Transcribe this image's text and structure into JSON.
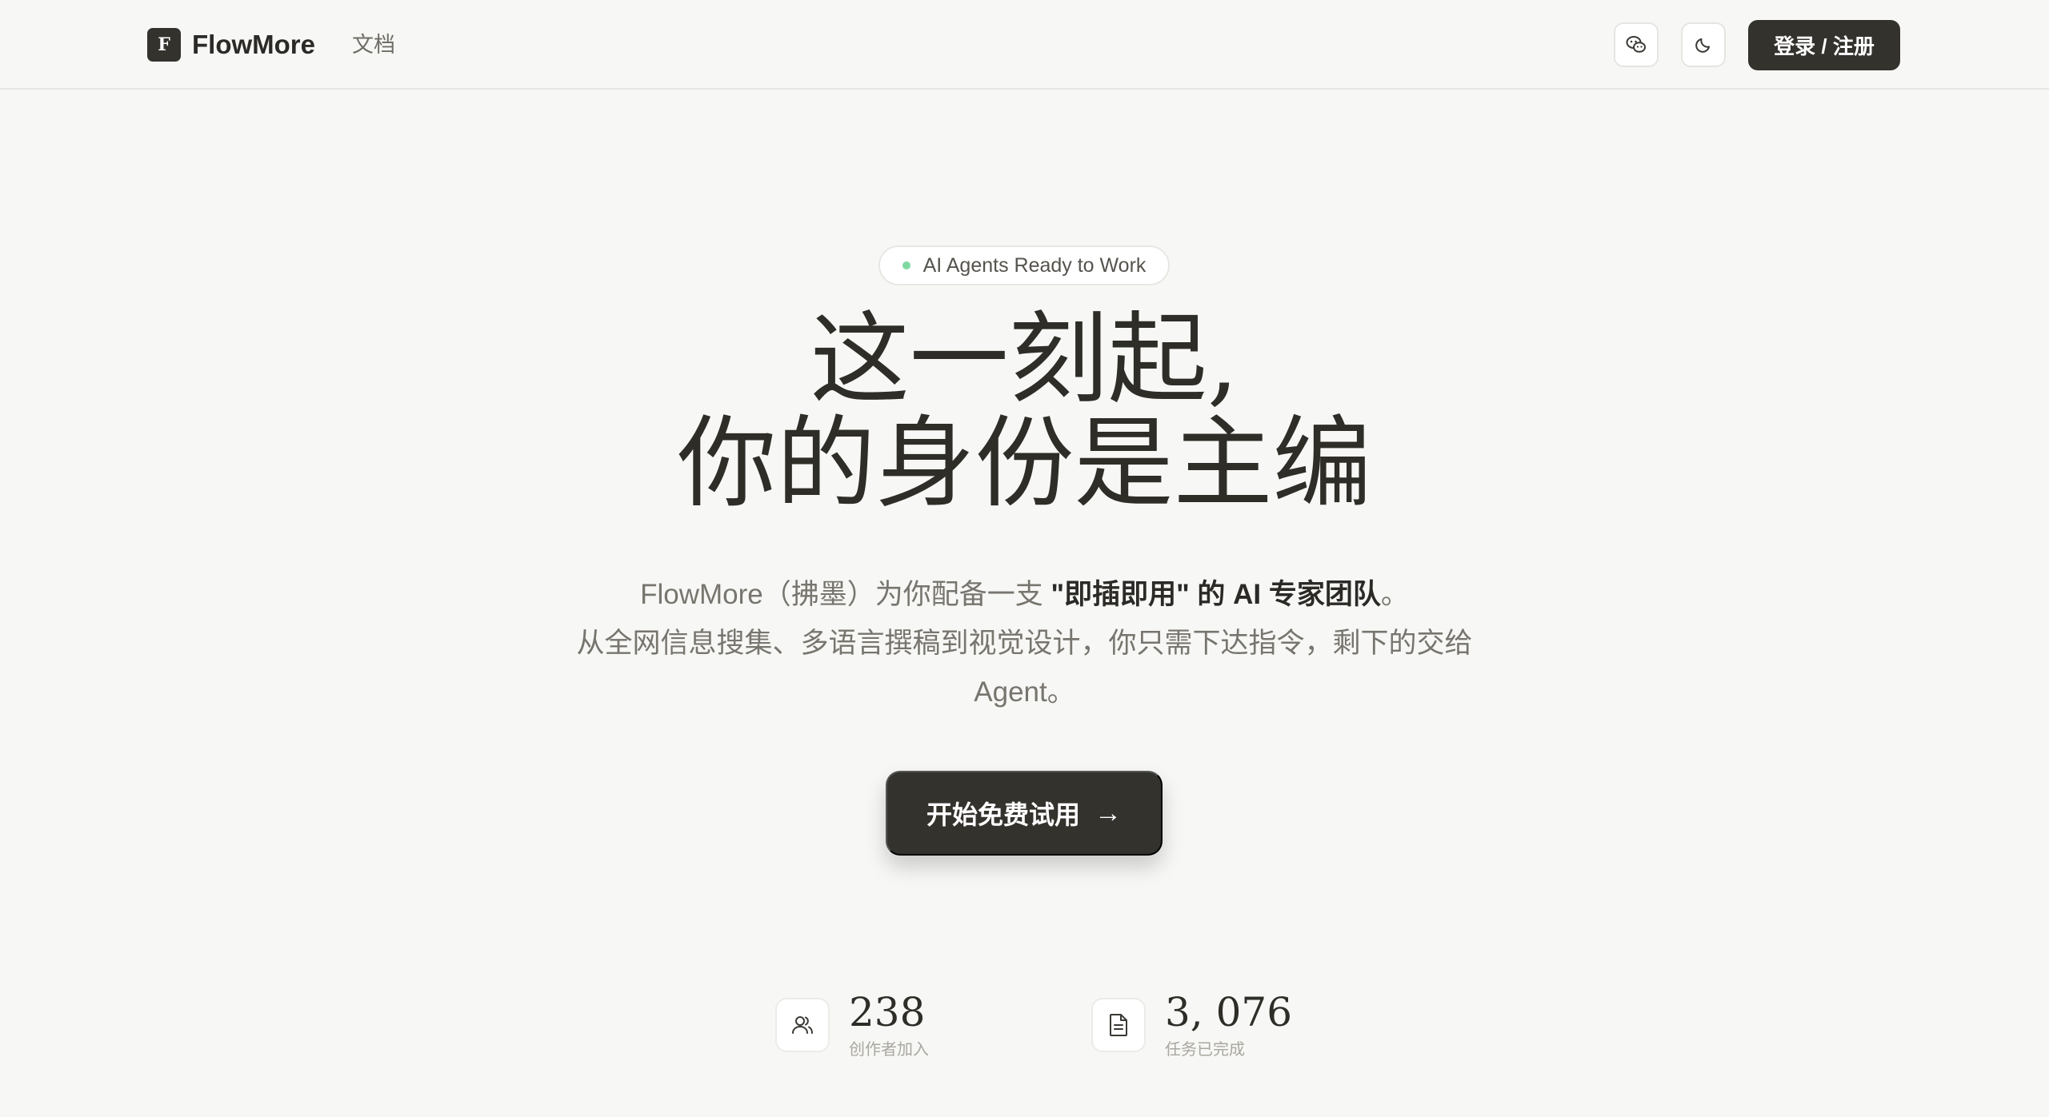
{
  "header": {
    "logo_letter": "F",
    "brand": "FlowMore",
    "nav_docs": "文档",
    "wechat_icon": "wechat-icon",
    "theme_icon": "moon-icon",
    "login_label": "登录 / 注册"
  },
  "hero": {
    "badge": "AI Agents Ready to Work",
    "badge_dot_color": "#7ed9a0",
    "title_line1": "这一刻起,",
    "title_line2": "你的身份是主编",
    "subtitle_line1_pre": "FlowMore（拂墨）为你配备一支 ",
    "subtitle_line1_bold": "\"即插即用\" 的 AI 专家团队",
    "subtitle_line1_post": "。",
    "subtitle_line2": "从全网信息搜集、多语言撰稿到视觉设计，你只需下达指令，剩下的交给",
    "subtitle_line3": "Agent。",
    "cta_label": "开始免费试用",
    "cta_arrow": "→"
  },
  "stats": [
    {
      "icon": "users-icon",
      "value": "238",
      "label": "创作者加入"
    },
    {
      "icon": "document-icon",
      "value": "3, 076",
      "label": "任务已完成"
    }
  ],
  "colors": {
    "background": "#f7f7f5",
    "primary_dark": "#34322d",
    "accent_green": "#7ed9a0"
  }
}
